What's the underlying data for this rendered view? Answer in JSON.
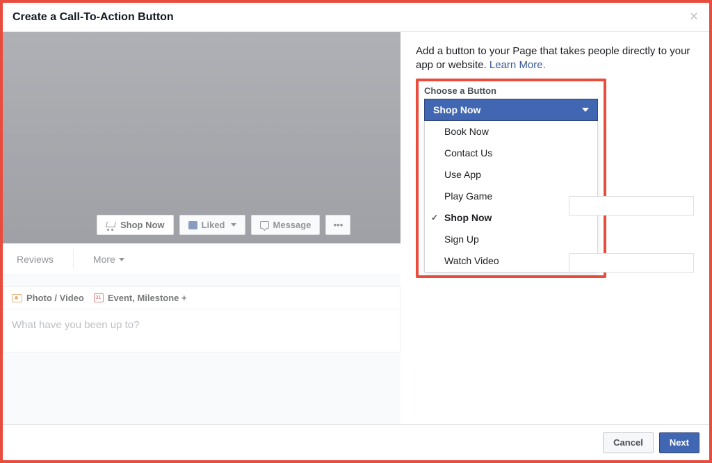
{
  "modal": {
    "title": "Create a Call-To-Action Button",
    "close_symbol": "×"
  },
  "preview": {
    "shop_now": "Shop Now",
    "liked": "Liked",
    "message": "Message",
    "ellipsis": "•••",
    "tabs": {
      "reviews": "Reviews",
      "more": "More"
    },
    "composer": {
      "photo_video": "Photo / Video",
      "event_milestone": "Event, Milestone +",
      "placeholder": "What have you been up to?"
    }
  },
  "right": {
    "intro": "Add a button to your Page that takes people directly to your app or website. ",
    "learn_more": "Learn More.",
    "choose_label": "Choose a Button",
    "selected": "Shop Now",
    "options": {
      "book_now": "Book Now",
      "contact_us": "Contact Us",
      "use_app": "Use App",
      "play_game": "Play Game",
      "shop_now": "Shop Now",
      "sign_up": "Sign Up",
      "watch_video": "Watch Video"
    }
  },
  "footer": {
    "cancel": "Cancel",
    "next": "Next"
  }
}
